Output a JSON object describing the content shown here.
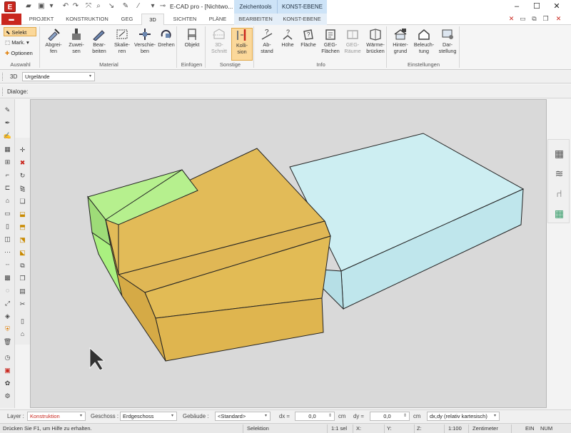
{
  "app": {
    "title": "E-CAD pro - [Nichtwo...",
    "logo_letter": "E"
  },
  "context_tabs": {
    "zeichentools": "Zeichentools",
    "konst_ebene": "KONST-EBENE"
  },
  "tabs": [
    "PROJEKT",
    "KONSTRUKTION",
    "GEG",
    "3D",
    "SICHTEN",
    "PLÄNE",
    "BEARBEITEN",
    "KONST-EBENE"
  ],
  "active_tab": "3D",
  "ribbon": {
    "auswahl": {
      "label": "Auswahl",
      "selekt": "Selekt",
      "mark": "Mark.",
      "optionen": "Optionen"
    },
    "material": {
      "label": "Material",
      "buttons": [
        "Abgrei-\nfen",
        "Zuwei-\nsen",
        "Bear-\nbeiten",
        "Skalie-\nren",
        "Verschie-\nben",
        "Drehen"
      ]
    },
    "einfuegen": {
      "label": "Einfügen",
      "objekt": "Objekt"
    },
    "sonstige": {
      "label": "Sonstige",
      "schnitt": "3D-\nSchnitt",
      "kollision": "Kolli-\nsion"
    },
    "info": {
      "label": "Info",
      "buttons": [
        "Ab-\nstand",
        "Höhe",
        "Fläche",
        "GEG-\nFlächen",
        "GEG-\nRäume",
        "Wärme-\nbrücken"
      ]
    },
    "einstellungen": {
      "label": "Einstellungen",
      "buttons": [
        "Hinter-\ngrund",
        "Beleuch-\ntung",
        "Dar-\nstellung"
      ]
    }
  },
  "bar3d": {
    "label": "3D",
    "selected": "Urgelände"
  },
  "dialog_bar": {
    "label": "Dialoge:"
  },
  "inputbar": {
    "layer_label": "Layer :",
    "layer_value": "Konstruktion",
    "geschoss_label": "Geschoss :",
    "geschoss_value": "Erdgeschoss",
    "gebaeude_label": "Gebäude :",
    "gebaeude_value": "<Standard>",
    "dx_label": "dx =",
    "dx_value": "0,0",
    "dx_unit": "cm",
    "dy_label": "dy =",
    "dy_value": "0,0",
    "dy_unit": "cm",
    "coord_mode": "dx,dy (relativ kartesisch)"
  },
  "statusbar": {
    "help": "Drücken Sie F1, um Hilfe zu erhalten.",
    "mode": "Selektion",
    "sel": "1:1 sel",
    "x": "X:",
    "y": "Y:",
    "z": "Z:",
    "scale": "1:100",
    "unit": "Zentimeter",
    "ein": "EIN",
    "num": "NUM"
  },
  "colors": {
    "accent_red": "#c9261d",
    "selected_orange": "#fbd89a",
    "building_yellow": "#e2bb58",
    "building_green": "#b6f08e",
    "building_cyan": "#cdeef2",
    "viewport_bg": "#d9d9d9"
  },
  "icons": {
    "left_toolbar": [
      "pencil-icon",
      "pen-icon",
      "pen-edit-icon",
      "wall-icon",
      "window-icon",
      "door-icon",
      "stair-icon",
      "roof-icon",
      "beam-icon",
      "column-icon",
      "opening-icon",
      "dots-icon",
      "line-icon",
      "grid-icon",
      "fill-icon",
      "layers-icon",
      "shield-icon",
      "trash-icon",
      "clock-icon",
      "monitor-icon",
      "paint-icon",
      "gear-icon"
    ],
    "left_toolbar2": [
      "move-icon",
      "delete-icon",
      "rotate-icon",
      "mirror-icon",
      "copy-icon",
      "scale-icon",
      "stretch-icon",
      "trim-icon",
      "extend-icon",
      "offset-icon",
      "array-icon",
      "paste-icon",
      "clipboard-icon",
      "scissors-icon",
      "page-icon",
      "house-page-icon"
    ],
    "right_toolbar": [
      "calculator-icon",
      "layers-stack-icon",
      "chair-icon",
      "color-palette-icon"
    ]
  }
}
